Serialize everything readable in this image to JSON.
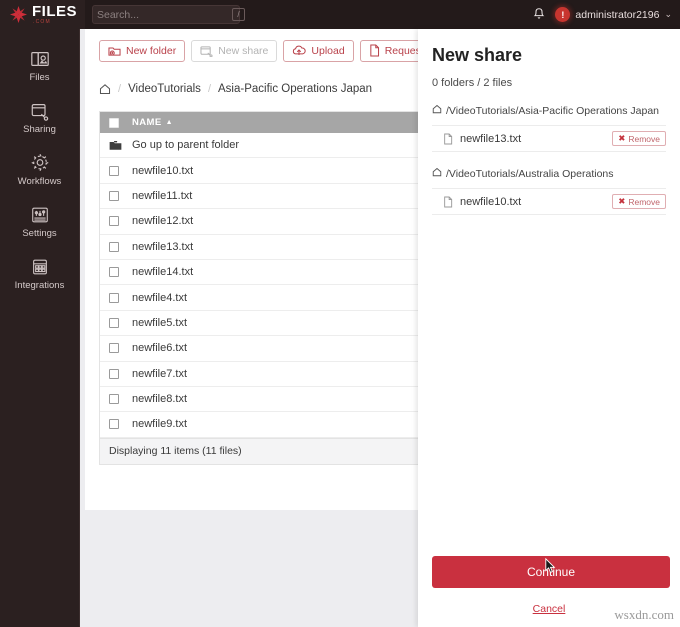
{
  "topbar": {
    "brand_name": "FILES",
    "brand_suffix": ".COM",
    "search_placeholder": "Search...",
    "search_value": "",
    "search_shortcut": "/",
    "bell_icon": "bell-icon",
    "username": "administrator2196",
    "avatar_initial": "!",
    "caret": "⌄"
  },
  "sidebar": {
    "items": [
      {
        "label": "Files",
        "icon": "files-icon"
      },
      {
        "label": "Sharing",
        "icon": "sharing-icon"
      },
      {
        "label": "Workflows",
        "icon": "gear-icon"
      },
      {
        "label": "Settings",
        "icon": "sliders-icon"
      },
      {
        "label": "Integrations",
        "icon": "grid-icon"
      }
    ]
  },
  "toolbar": {
    "new_folder": "New folder",
    "new_share": "New share",
    "upload": "Upload",
    "request": "Request",
    "link_icon": "link-icon",
    "chevron_right": "›"
  },
  "breadcrumb": {
    "home_icon": "home-icon",
    "separator": "/",
    "items": [
      "VideoTutorials",
      "Asia-Pacific Operations Japan"
    ]
  },
  "table": {
    "header": {
      "name": "NAME",
      "sort_indicator": "▲"
    },
    "parent_row": {
      "label": "Go up to parent folder",
      "icon": "folder-up-icon"
    },
    "rows": [
      {
        "name": "newfile10.txt",
        "checked": false
      },
      {
        "name": "newfile11.txt",
        "checked": false
      },
      {
        "name": "newfile12.txt",
        "checked": false
      },
      {
        "name": "newfile13.txt",
        "checked": false
      },
      {
        "name": "newfile14.txt",
        "checked": false
      },
      {
        "name": "newfile4.txt",
        "checked": false
      },
      {
        "name": "newfile5.txt",
        "checked": false
      },
      {
        "name": "newfile6.txt",
        "checked": false
      },
      {
        "name": "newfile7.txt",
        "checked": false
      },
      {
        "name": "newfile8.txt",
        "checked": false
      },
      {
        "name": "newfile9.txt",
        "checked": false
      }
    ],
    "footer": "Displaying 11 items (11 files)"
  },
  "share_panel": {
    "title": "New share",
    "count": "0 folders / 2 files",
    "groups": [
      {
        "path": "/VideoTutorials/Asia-Pacific Operations Japan",
        "files": [
          {
            "name": "newfile13.txt",
            "remove_label": "Remove"
          }
        ]
      },
      {
        "path": "/VideoTutorials/Australia Operations",
        "files": [
          {
            "name": "newfile10.txt",
            "remove_label": "Remove"
          }
        ]
      }
    ],
    "continue_label": "Continue",
    "cancel_label": "Cancel"
  },
  "watermark": "wsxdn.com",
  "colors": {
    "brand_red": "#c9303f",
    "topbar_bg": "#231a1a",
    "sidebar_bg": "#2b2020",
    "main_bg": "#ededf0",
    "table_header_bg": "#a6a6a6"
  }
}
